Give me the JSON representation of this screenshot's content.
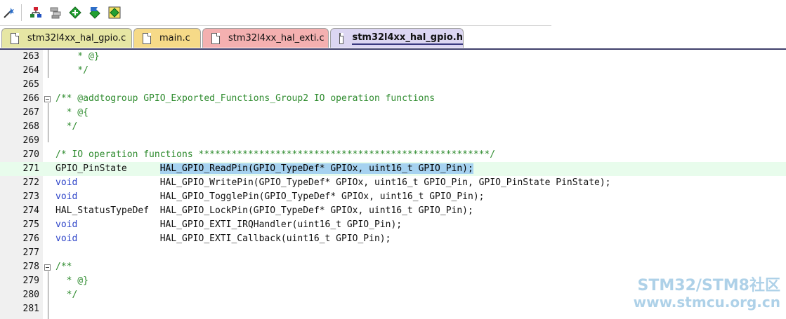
{
  "toolbar": {
    "buttons": [
      {
        "name": "wizard-icon",
        "color": "#3a3a3a"
      },
      {
        "name": "tree-up-icon",
        "color": "#c0202a"
      },
      {
        "name": "tree-stack-icon",
        "color": "#7a7a7a"
      },
      {
        "name": "diamond-move-icon",
        "color": "#1e8c2a"
      },
      {
        "name": "diamond-flag-icon",
        "color": "#1e8c2a"
      },
      {
        "name": "diamond-box-icon",
        "color": "#1e8c2a"
      }
    ]
  },
  "tabs": [
    {
      "label": "stm32l4xx_hal_gpio.c",
      "color": "#e6e6a4",
      "active": false
    },
    {
      "label": "main.c",
      "color": "#f6da88",
      "active": false
    },
    {
      "label": "stm32l4xx_hal_exti.c",
      "color": "#f4b0b0",
      "active": false
    },
    {
      "label": "stm32l4xx_hal_gpio.h",
      "color": "#dcd6f2",
      "active": true
    }
  ],
  "editor": {
    "lines": [
      {
        "num": "263",
        "parts": [
          {
            "t": "    * @}",
            "c": "cm"
          }
        ]
      },
      {
        "num": "264",
        "parts": [
          {
            "t": "    */",
            "c": "cm"
          }
        ]
      },
      {
        "num": "265",
        "parts": []
      },
      {
        "num": "266",
        "parts": [
          {
            "t": "/** @addtogroup GPIO_Exported_Functions_Group2 IO operation functions",
            "c": "cm"
          }
        ]
      },
      {
        "num": "267",
        "parts": [
          {
            "t": "  * @{",
            "c": "cm"
          }
        ]
      },
      {
        "num": "268",
        "parts": [
          {
            "t": "  */",
            "c": "cm"
          }
        ]
      },
      {
        "num": "269",
        "parts": []
      },
      {
        "num": "270",
        "parts": [
          {
            "t": "/* IO operation functions *****************************************************/",
            "c": "cm"
          }
        ]
      },
      {
        "num": "271",
        "highlight": true,
        "parts": [
          {
            "t": "GPIO_PinState      ",
            "c": "ty"
          },
          {
            "t": "HAL_GPIO_ReadPin(GPIO_TypeDef* GPIOx, uint16_t GPIO_Pin);",
            "c": "sel"
          }
        ]
      },
      {
        "num": "272",
        "parts": [
          {
            "t": "void               ",
            "c": "kw"
          },
          {
            "t": "HAL_GPIO_WritePin(GPIO_TypeDef* GPIOx, uint16_t GPIO_Pin, GPIO_PinState PinState);",
            "c": "ty"
          }
        ]
      },
      {
        "num": "273",
        "parts": [
          {
            "t": "void               ",
            "c": "kw"
          },
          {
            "t": "HAL_GPIO_TogglePin(GPIO_TypeDef* GPIOx, uint16_t GPIO_Pin);",
            "c": "ty"
          }
        ]
      },
      {
        "num": "274",
        "parts": [
          {
            "t": "HAL_StatusTypeDef  ",
            "c": "ty"
          },
          {
            "t": "HAL_GPIO_LockPin(GPIO_TypeDef* GPIOx, uint16_t GPIO_Pin);",
            "c": "ty"
          }
        ]
      },
      {
        "num": "275",
        "parts": [
          {
            "t": "void               ",
            "c": "kw"
          },
          {
            "t": "HAL_GPIO_EXTI_IRQHandler(uint16_t GPIO_Pin);",
            "c": "ty"
          }
        ]
      },
      {
        "num": "276",
        "parts": [
          {
            "t": "void               ",
            "c": "kw"
          },
          {
            "t": "HAL_GPIO_EXTI_Callback(uint16_t GPIO_Pin);",
            "c": "ty"
          }
        ]
      },
      {
        "num": "277",
        "parts": []
      },
      {
        "num": "278",
        "parts": [
          {
            "t": "/**",
            "c": "cm"
          }
        ]
      },
      {
        "num": "279",
        "parts": [
          {
            "t": "  * @}",
            "c": "cm"
          }
        ]
      },
      {
        "num": "280",
        "parts": [
          {
            "t": "  */",
            "c": "cm"
          }
        ]
      },
      {
        "num": "281",
        "parts": []
      }
    ]
  },
  "watermark": {
    "line1": "STM32/STM8社区",
    "line2": "www.stmcu.org.cn"
  }
}
